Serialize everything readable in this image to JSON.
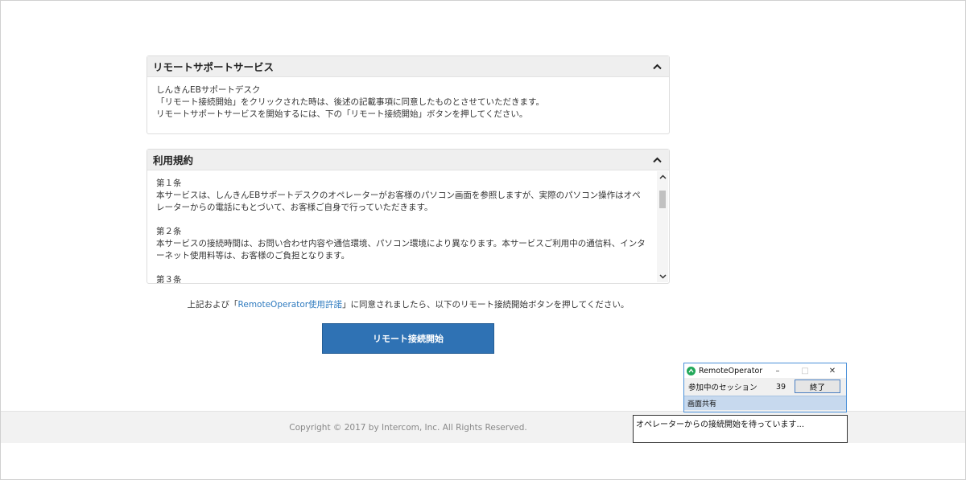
{
  "support_panel": {
    "title": "リモートサポートサービス",
    "lines": [
      "しんきんEBサポートデスク",
      "「リモート接続開始」をクリックされた時は、後述の記載事項に同意したものとさせていただきます。",
      "リモートサポートサービスを開始するには、下の「リモート接続開始」ボタンを押してください。"
    ]
  },
  "terms_panel": {
    "title": "利用規約",
    "articles": [
      {
        "heading": "第１条",
        "text": "本サービスは、しんきんEBサポートデスクのオペレーターがお客様のパソコン画面を参照しますが、実際のパソコン操作はオペレーターからの電話にもとづいて、お客様ご自身で行っていただきます。"
      },
      {
        "heading": "第２条",
        "text": "本サービスの接続時間は、お問い合わせ内容や通信環境、パソコン環境により異なります。本サービスご利用中の通信料、インターネット使用料等は、お客様のご負担となります。"
      },
      {
        "heading": "第３条",
        "text": ""
      }
    ]
  },
  "consent": {
    "prefix": "上記および「",
    "link": "RemoteOperator使用許諾",
    "suffix": "」に同意されましたら、以下のリモート接続開始ボタンを押してください。"
  },
  "start_button": {
    "label": "リモート接続開始"
  },
  "footer": {
    "copyright": "Copyright © 2017 by Intercom, Inc. All Rights Reserved."
  },
  "remote_operator": {
    "title": "RemoteOperator",
    "minimize": "–",
    "maximize": "□",
    "close": "✕",
    "session_label": "参加中のセッション",
    "session_count": "39",
    "end_button": "終了",
    "tab": "画面共有",
    "status": "オペレーターからの接続開始を待っています..."
  },
  "colors": {
    "primary_button": "#2f72b4",
    "link": "#2f7bbf",
    "panel_header": "#efefef",
    "footer": "#f2f2f2"
  }
}
